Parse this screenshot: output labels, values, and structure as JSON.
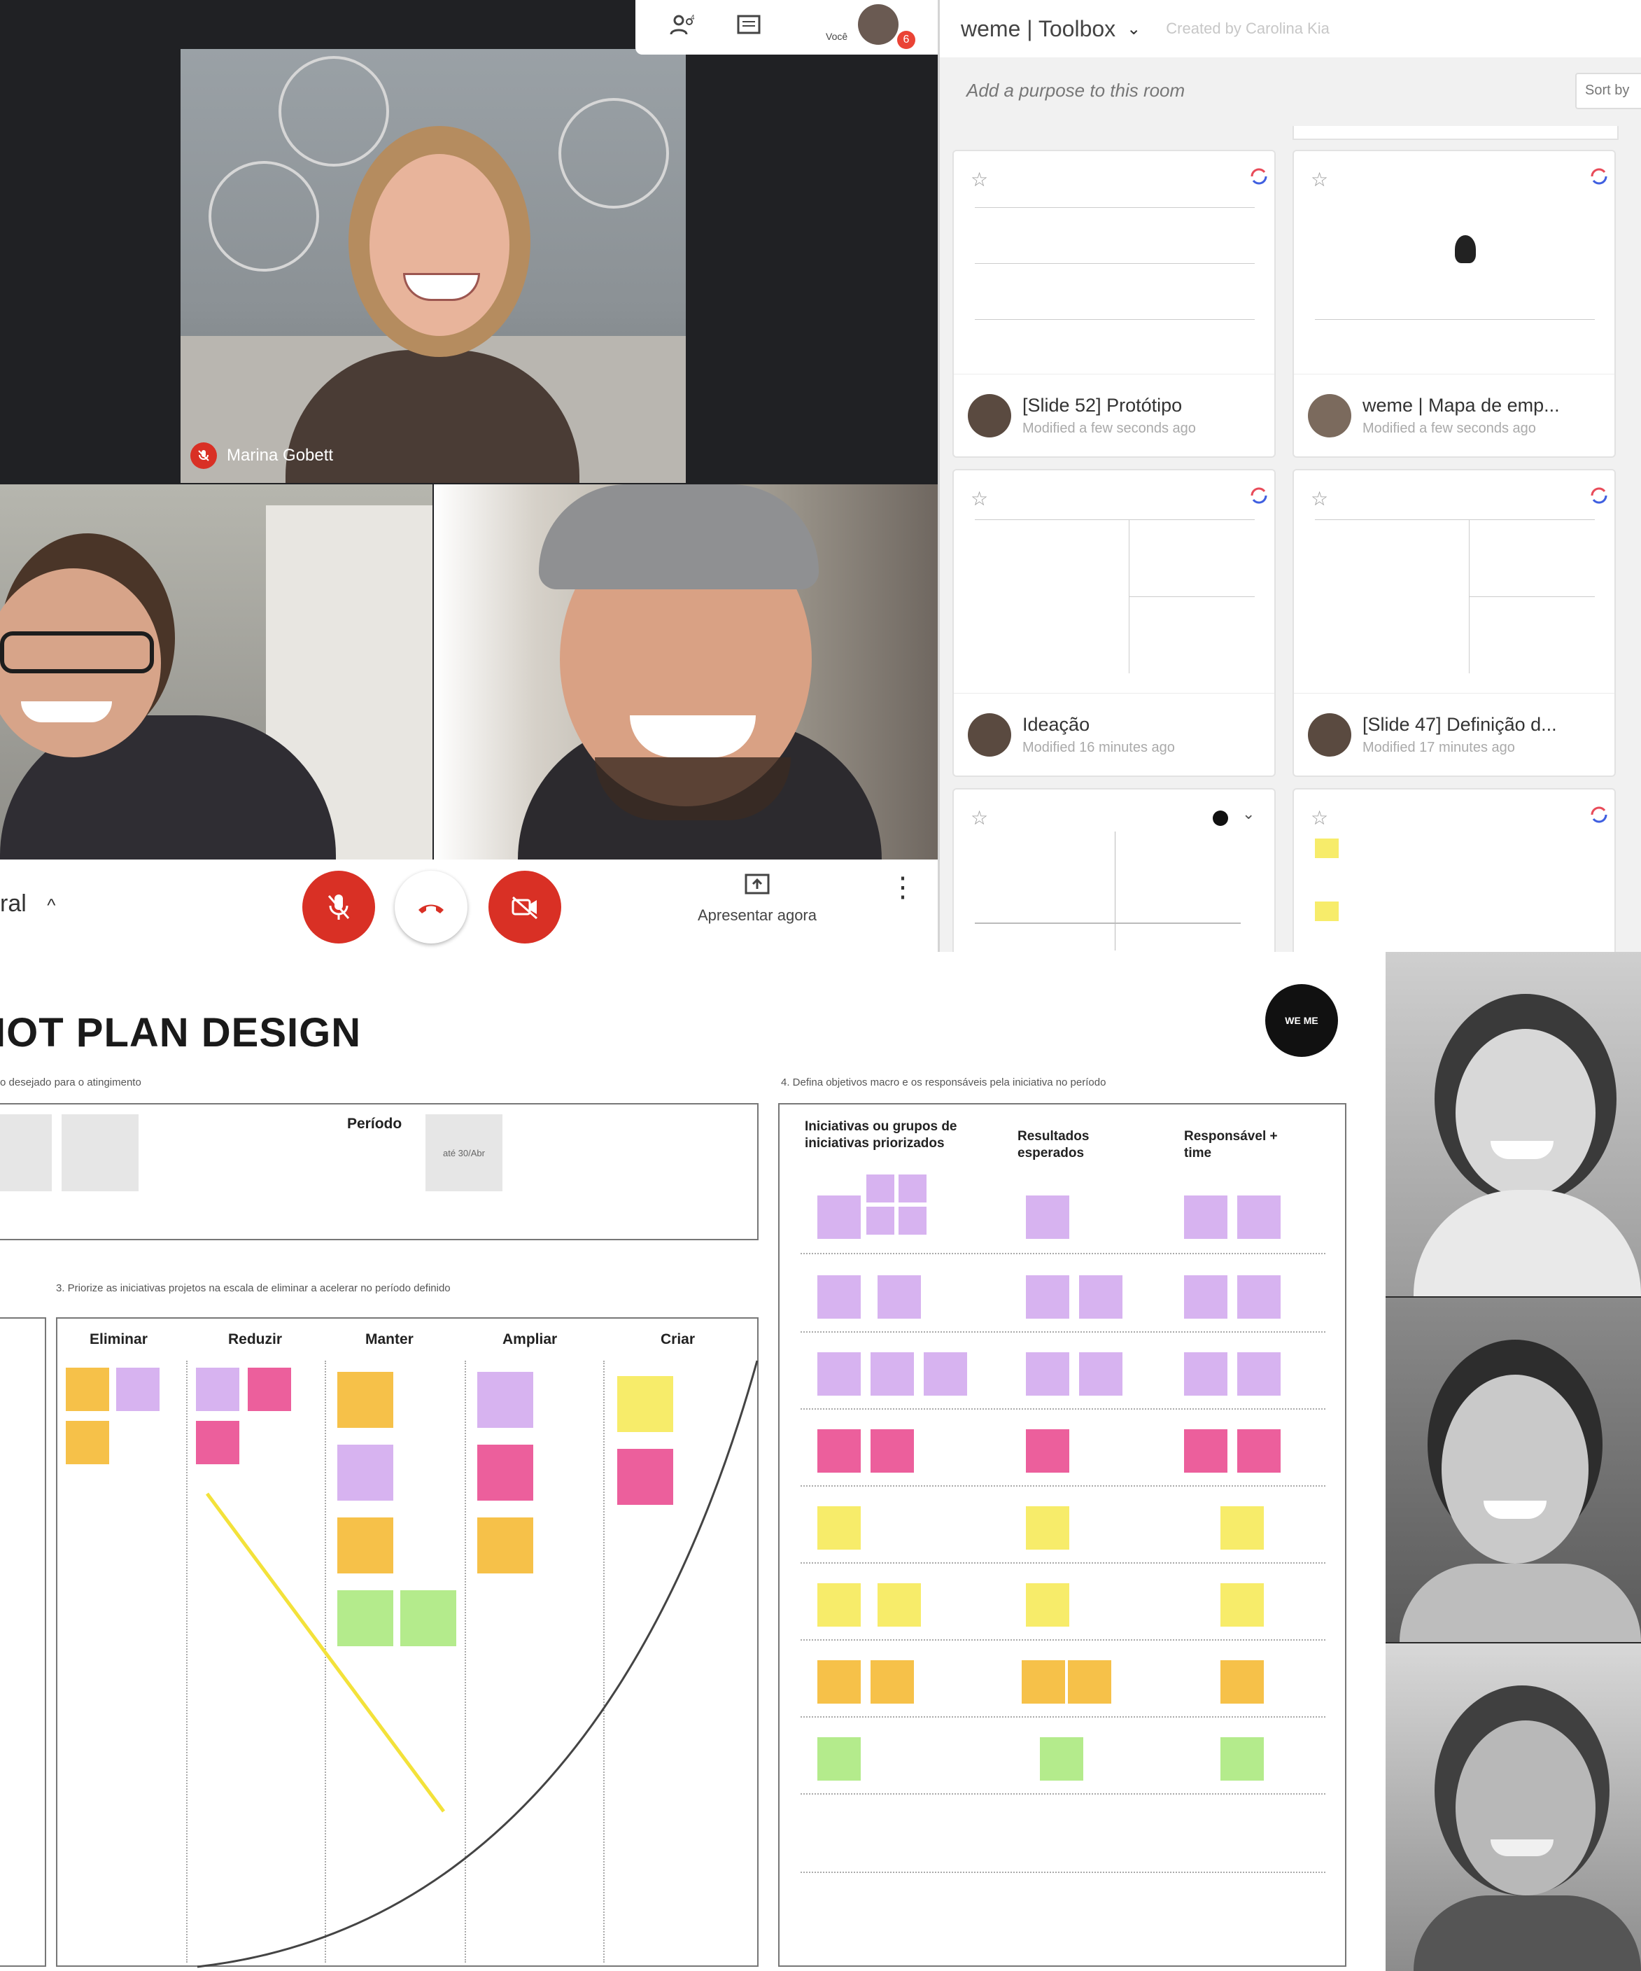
{
  "meet": {
    "participant_name": "Marina Gobett",
    "self_label": "Você",
    "notification_count": "6",
    "present_label": "Apresentar agora",
    "details_label": "ral"
  },
  "mural": {
    "room_title": "weme | Toolbox",
    "created_by": "Created by Carolina Kia",
    "purpose_placeholder": "Add a purpose to this room",
    "sort_label": "Sort by",
    "cards": [
      {
        "title": "[Slide 52] Protótipo",
        "subtitle": "Modified a few seconds ago"
      },
      {
        "title": "weme | Mapa de emp...",
        "subtitle": "Modified a few seconds ago"
      },
      {
        "title": "Ideação",
        "subtitle": "Modified 16 minutes ago"
      },
      {
        "title": "[Slide 47] Definição d...",
        "subtitle": "Modified 17 minutes ago"
      }
    ]
  },
  "board": {
    "title": "IOT PLAN DESIGN",
    "subtitle": "o desejado para o atingimento",
    "period_label": "Período",
    "period_value": "até 30/Abr",
    "step3": "3. Priorize as iniciativas projetos na escala de eliminar a acelerar no período definido",
    "step4": "4. Defina objetivos macro e os responsáveis pela iniciativa no período",
    "columns": [
      "Eliminar",
      "Reduzir",
      "Manter",
      "Ampliar",
      "Criar"
    ],
    "right_headers": [
      "Iniciativas ou grupos de iniciativas priorizados",
      "Resultados esperados",
      "Responsável + time"
    ],
    "logo_text": "WE ME"
  },
  "colors": {
    "accent_red": "#d93025",
    "sticky_purple": "#d7b3f0",
    "sticky_pink": "#ec5f9c",
    "sticky_yellow": "#f7ec6a",
    "sticky_orange": "#f6c149",
    "sticky_green": "#b4eb8c"
  },
  "icons": [
    "people-icon",
    "chat-icon",
    "mic-off-icon",
    "end-call-icon",
    "camera-off-icon",
    "present-icon",
    "more-icon",
    "star-icon",
    "chevron-down-icon",
    "chevron-up-icon",
    "mural-logo-icon"
  ]
}
